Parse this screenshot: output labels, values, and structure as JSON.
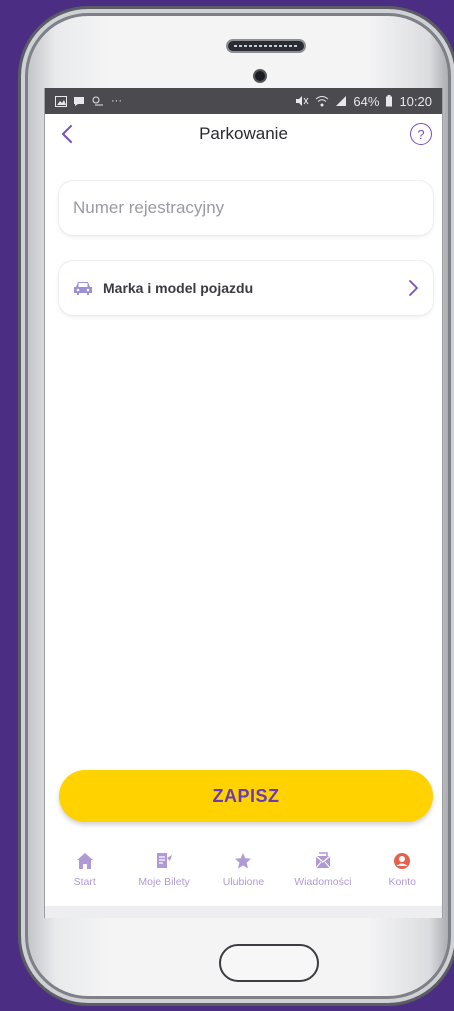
{
  "status_bar": {
    "left_dots": "···",
    "signal": "64%",
    "time": "10:20"
  },
  "header": {
    "title": "Parkowanie",
    "help": "?"
  },
  "form": {
    "plate_placeholder": "Numer rejestracyjny",
    "plate_value": "",
    "vehicle_label": "Marka i model pojazdu"
  },
  "actions": {
    "save_label": "ZAPISZ"
  },
  "nav": {
    "items": [
      {
        "label": "Start",
        "icon": "home-icon"
      },
      {
        "label": "Moje Bilety",
        "icon": "tickets-icon"
      },
      {
        "label": "Ulubione",
        "icon": "star-icon"
      },
      {
        "label": "Wiadomości",
        "icon": "mail-icon"
      },
      {
        "label": "Konto",
        "icon": "account-icon"
      }
    ],
    "active": "Konto"
  },
  "colors": {
    "accent": "#7b4fc0",
    "save": "#ffd200",
    "nav_inactive": "#b09ad6",
    "nav_active": "#e8604c",
    "background": "#4b2d83"
  }
}
